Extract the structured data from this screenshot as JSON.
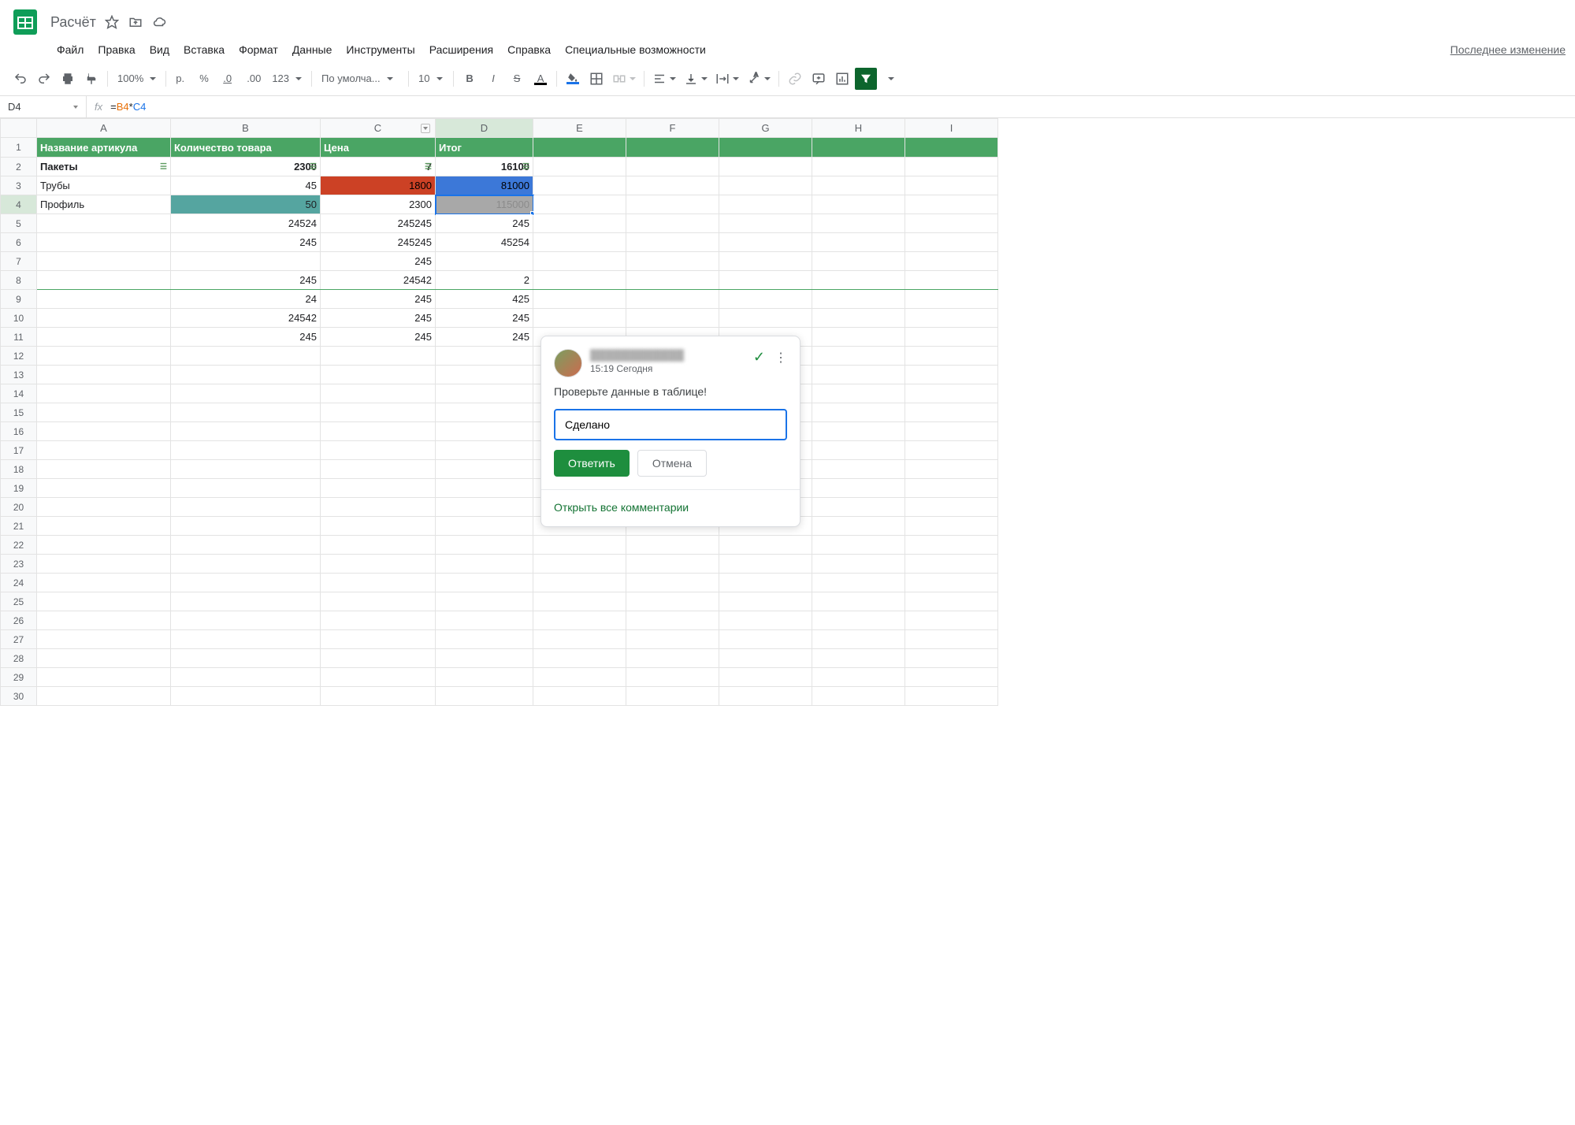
{
  "doc": {
    "title": "Расчёт"
  },
  "menu": {
    "items": [
      "Файл",
      "Правка",
      "Вид",
      "Вставка",
      "Формат",
      "Данные",
      "Инструменты",
      "Расширения",
      "Справка",
      "Специальные возможности"
    ],
    "last_edit": "Последнее изменение"
  },
  "toolbar": {
    "zoom": "100%",
    "currency": "р.",
    "percent": "%",
    "dec_less": ".0",
    "dec_more": ".00",
    "numfmt": "123",
    "font": "По умолча...",
    "fontsize": "10"
  },
  "formula": {
    "cellref": "D4",
    "text": "=B4*C4",
    "parts": {
      "eq": "=",
      "b": "B4",
      "op": "*",
      "c": "C4"
    }
  },
  "columns": [
    "A",
    "B",
    "C",
    "D",
    "E",
    "F",
    "G",
    "H",
    "I"
  ],
  "headers": {
    "a": "Название артикула",
    "b": "Количество товара",
    "c": "Цена",
    "d": "Итог"
  },
  "rows": {
    "r2": {
      "a": "Пакеты",
      "b": "2300",
      "c": "7",
      "d": "16100"
    },
    "r3": {
      "a": "Трубы",
      "b": "45",
      "c": "1800",
      "d": "81000"
    },
    "r4": {
      "a": "Профиль",
      "b": "50",
      "c": "2300",
      "d": "115000"
    },
    "r5": {
      "b": "24524",
      "c": "245245",
      "d": "245"
    },
    "r6": {
      "b": "245",
      "c": "245245",
      "d": "45254"
    },
    "r7": {
      "c": "245"
    },
    "r8": {
      "b": "245",
      "c": "24542",
      "d": "2"
    },
    "r9": {
      "b": "24",
      "c": "245",
      "d": "425"
    },
    "r10": {
      "b": "24542",
      "c": "245",
      "d": "245"
    },
    "r11": {
      "b": "245",
      "c": "245",
      "d": "245"
    }
  },
  "comment": {
    "time": "15:19 Сегодня",
    "body": "Проверьте данные в таблице!",
    "reply_value": "Сделано",
    "btn_reply": "Ответить",
    "btn_cancel": "Отмена",
    "open_all": "Открыть все комментарии"
  }
}
